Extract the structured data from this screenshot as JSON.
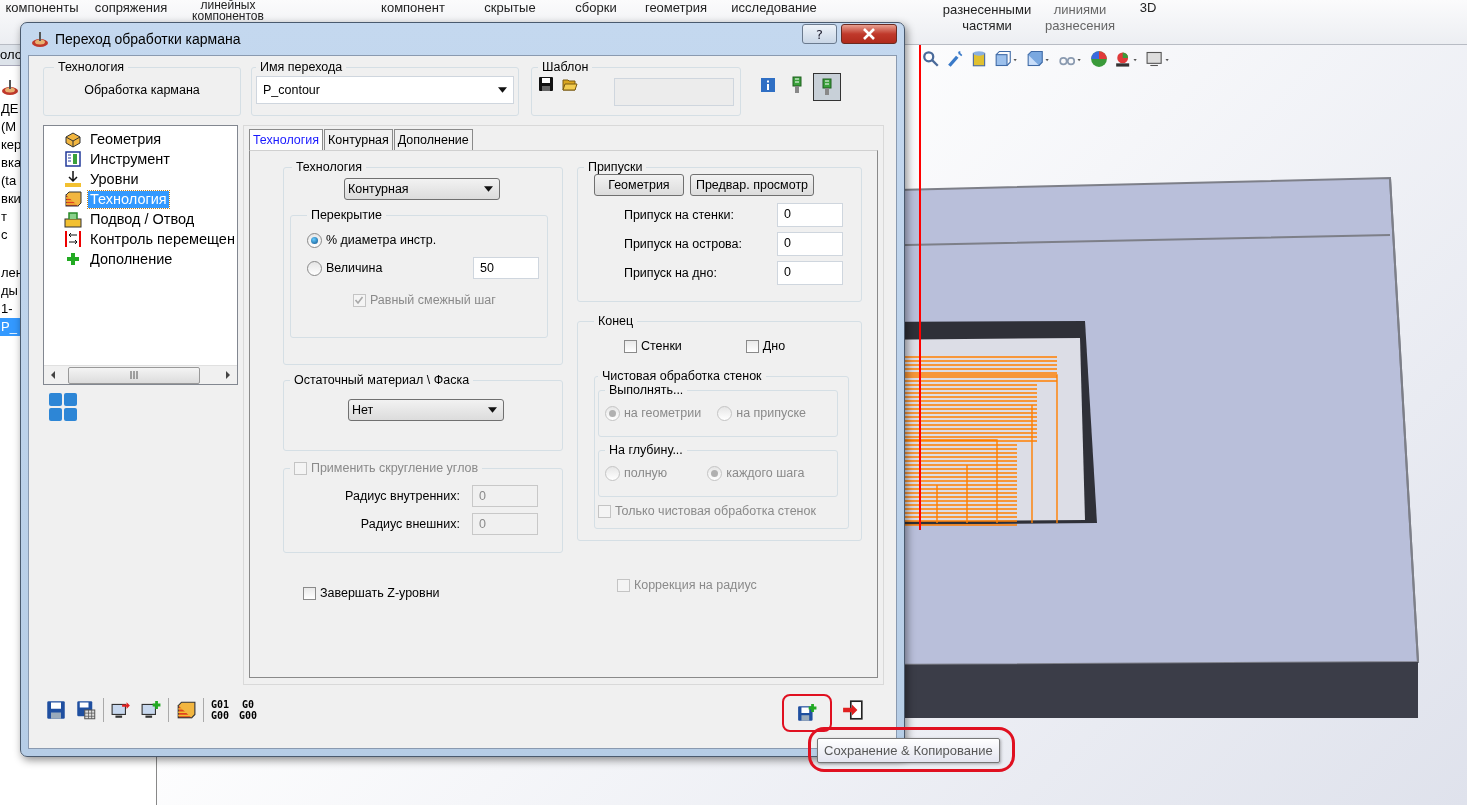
{
  "ribbon": [
    {
      "lines": [
        "компоненты"
      ]
    },
    {
      "lines": [
        "сопряжения"
      ]
    },
    {
      "lines": [
        "линейных",
        "компонентов"
      ]
    },
    {
      "lines": [
        "компонент"
      ]
    },
    {
      "lines": [
        "скрытые"
      ]
    },
    {
      "lines": [
        "сборки"
      ]
    },
    {
      "lines": [
        "геометрия"
      ]
    },
    {
      "lines": [
        "исследование"
      ]
    },
    {
      "lines": [
        "разнесенными",
        "частями"
      ]
    },
    {
      "lines": [
        "линиями",
        "разнесения"
      ]
    },
    {
      "lines": [
        "3D"
      ]
    }
  ],
  "feature_tree": {
    "tab": "оло",
    "items": [
      {
        "label": "ДЕ",
        "selected": false
      },
      {
        "label": "(М",
        "selected": false
      },
      {
        "label": "кер",
        "selected": false
      },
      {
        "label": "вка",
        "selected": false
      },
      {
        "label": "(ta",
        "selected": false
      },
      {
        "label": "вки",
        "selected": false
      },
      {
        "label": "т",
        "selected": false
      },
      {
        "label": "с",
        "selected": false
      },
      {
        "label": "лен",
        "selected": false
      },
      {
        "label": "ды",
        "selected": false
      },
      {
        "label": "1-",
        "selected": false
      },
      {
        "label": "P_",
        "selected": true
      }
    ]
  },
  "dialog": {
    "title": "Переход обработки кармана",
    "help": "?",
    "technology": {
      "legend": "Технология",
      "value": "Обработка кармана"
    },
    "operation_name": {
      "legend": "Имя перехода",
      "value": "P_contour"
    },
    "template": {
      "legend": "Шаблон"
    },
    "tool_buttons": [
      {
        "pressed": false
      },
      {
        "pressed": true
      }
    ],
    "tree": [
      {
        "label": "Геометрия",
        "selected": false
      },
      {
        "label": "Инструмент",
        "selected": false
      },
      {
        "label": "Уровни",
        "selected": false
      },
      {
        "label": "Технология",
        "selected": true
      },
      {
        "label": "Подвод / Отвод",
        "selected": false
      },
      {
        "label": "Контроль перемещен",
        "selected": false
      },
      {
        "label": "Дополнение",
        "selected": false
      }
    ],
    "tabs": [
      {
        "label": "Технология",
        "selected": true
      },
      {
        "label": "Контурная",
        "selected": false
      },
      {
        "label": "Дополнение",
        "selected": false
      }
    ],
    "tech_group": {
      "legend": "Технология",
      "strategy": "Контурная",
      "overlap": {
        "legend": "Перекрытие",
        "options": [
          {
            "label": "% диаметра инстр.",
            "selected": true
          },
          {
            "label": "Величина",
            "selected": false
          }
        ],
        "value": "50",
        "equal_step": {
          "label": "Равный смежный шаг",
          "checked": true,
          "disabled": true
        }
      }
    },
    "rest_group": {
      "legend": "Остаточный материал \\ Фаска",
      "value": "Нет"
    },
    "corner_group": {
      "checkbox": {
        "label": "Применить скругление углов",
        "checked": false,
        "disabled": true
      },
      "fields": [
        {
          "label": "Радиус внутренних:",
          "value": "0",
          "disabled": true
        },
        {
          "label": "Радиус внешних:",
          "value": "0",
          "disabled": true
        }
      ]
    },
    "finish_z": {
      "label": "Завершать Z-уровни",
      "checked": false,
      "disabled": false
    },
    "allowances": {
      "legend": "Припуски",
      "buttons": [
        "Геометрия",
        "Предвар. просмотр"
      ],
      "fields": [
        {
          "label": "Припуск на стенки:",
          "value": "0"
        },
        {
          "label": "Припуск на острова:",
          "value": "0"
        },
        {
          "label": "Припуск на дно:",
          "value": "0"
        }
      ]
    },
    "end_group": {
      "legend": "Конец",
      "checks": [
        {
          "label": "Стенки",
          "checked": false,
          "disabled": false
        },
        {
          "label": "Дно",
          "checked": false,
          "disabled": false
        }
      ],
      "wall_finish": {
        "legend": "Чистовая обработка стенок",
        "groups": [
          {
            "legend": "Выполнять...",
            "options": [
              {
                "label": "на геометрии",
                "selected": true,
                "disabled": true
              },
              {
                "label": "на припуске",
                "selected": false,
                "disabled": true
              }
            ]
          },
          {
            "legend": "На глубину...",
            "options": [
              {
                "label": "полную",
                "selected": false,
                "disabled": true
              },
              {
                "label": "каждого шага",
                "selected": true,
                "disabled": true
              }
            ]
          }
        ],
        "only": {
          "label": "Только чистовая обработка стенок",
          "checked": false,
          "disabled": true
        }
      }
    },
    "radius_correction": {
      "label": "Коррекция на радиус",
      "checked": false,
      "disabled": true
    },
    "gcode_buttons": [
      [
        "G01",
        "G00"
      ],
      [
        "G0",
        "G00"
      ]
    ],
    "save_copy": {
      "highlight": true
    }
  },
  "tooltip": {
    "text": "Сохранение & Копирование",
    "highlight": true
  }
}
